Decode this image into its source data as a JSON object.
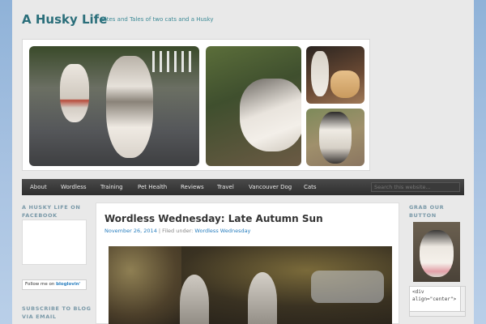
{
  "site": {
    "title": "A Husky Life",
    "description": "Bites and Tales of two cats and a Husky"
  },
  "nav": {
    "items": [
      "About",
      "Wordless",
      "Training",
      "Pet Health",
      "Reviews",
      "Travel",
      "Vancouver Dog",
      "Cats"
    ],
    "search_placeholder": "Search this website..."
  },
  "sidebar_left": {
    "facebook_heading_1": "A HUSKY LIFE ON",
    "facebook_heading_2": "FACEBOOK",
    "bloglovin_prefix": "Follow me on",
    "bloglovin_brand": "bloglovin'",
    "subscribe_heading_1": "SUBSCRIBE TO BLOG",
    "subscribe_heading_2": "VIA EMAIL"
  },
  "post": {
    "title": "Wordless Wednesday: Late Autumn Sun",
    "date": "November 26, 2014",
    "filed_label": "| Filed under:",
    "category": "Wordless Wednesday"
  },
  "sidebar_right": {
    "grab_heading_1": "GRAB OUR",
    "grab_heading_2": "BUTTON",
    "code_line_1": "<div",
    "code_line_2": "align=\"center\">"
  },
  "colors": {
    "title": "#2a6e7a",
    "link": "#2a7fbf",
    "nav_bg": "#333333",
    "sidebar_heading": "#7a99a8"
  }
}
